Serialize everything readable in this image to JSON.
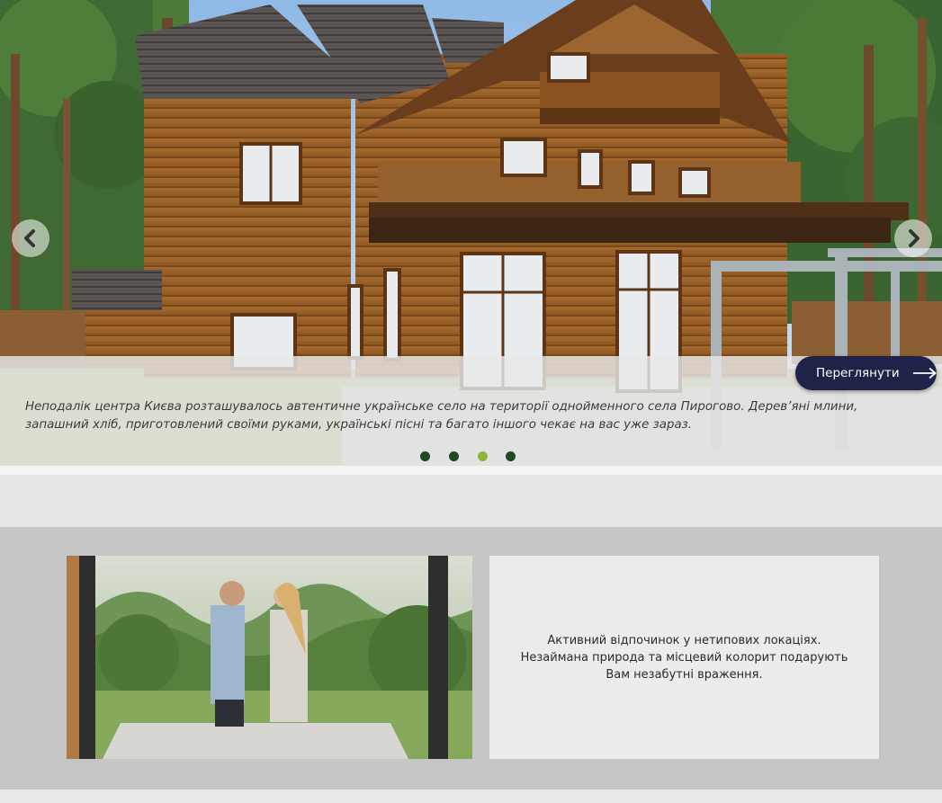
{
  "hero": {
    "caption": "Неподалік центра Києва розташувалось автентичне українське село на території однойменного села Пирогово. Дерев’яні млини, запашний хліб, приготовлений своїми руками, українські пісні та багато іншого чекає на вас уже зараз.",
    "view_button_label": "Переглянути",
    "prev_icon": "chevron-left-icon",
    "next_icon": "chevron-right-icon",
    "slide_count": 4,
    "active_slide": 3
  },
  "feature": {
    "text": "Активний відпочинок у нетипових локаціях. Незаймана природа та місцевий колорит подарують Вам незабутні враження."
  },
  "colors": {
    "button_bg": "#1f2347",
    "dot": "#1d4a1f",
    "dot_active": "#8db53c",
    "section_bg": "#c6c6c6"
  }
}
